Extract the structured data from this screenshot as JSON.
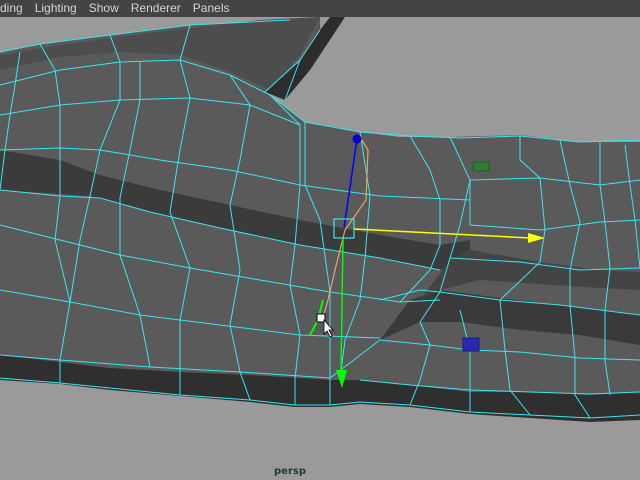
{
  "menubar": {
    "items": [
      {
        "label": "ding"
      },
      {
        "label": "Lighting"
      },
      {
        "label": "Show"
      },
      {
        "label": "Renderer"
      },
      {
        "label": "Panels"
      }
    ]
  },
  "viewport": {
    "camera_label": "persp",
    "background_color": "#9a9a9a",
    "wireframe_color": "#39e6f0",
    "mesh_color": "#5a5a5a"
  },
  "manipulator": {
    "x_axis_color": "#ffff00",
    "y_axis_color": "#00ff00",
    "z_axis_color": "#0000ff",
    "handle": "move-tool-handle"
  }
}
